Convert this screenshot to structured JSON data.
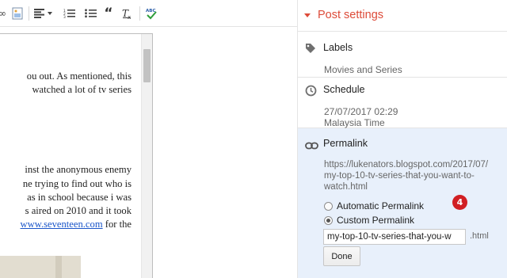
{
  "editor": {
    "lines": [
      "ou out. As mentioned, this",
      "watched a lot of tv series",
      "inst the anonymous enemy",
      "ne trying to find out who is",
      "as in school because i was",
      "s aired on 2010 and it took",
      "for the"
    ],
    "link_text": "www.seventeen.com"
  },
  "post_settings": {
    "title": "Post settings",
    "labels": {
      "title": "Labels",
      "value": "Movies and Series"
    },
    "schedule": {
      "title": "Schedule",
      "date": "27/07/2017 02:29",
      "timezone": "Malaysia Time"
    },
    "permalink": {
      "title": "Permalink",
      "url_lines": [
        "https://lukenators.blogspot.com/2017/07/",
        "my-top-10-tv-series-that-you-want-to-",
        "watch.html"
      ],
      "option_automatic": "Automatic Permalink",
      "option_custom": "Custom Permalink",
      "selected": "custom",
      "input_value": "my-top-10-tv-series-that-you-w",
      "suffix": ".html",
      "done_label": "Done",
      "step_badge": "4"
    }
  },
  "colors": {
    "accent": "#dd4b39",
    "permalink_bg": "#e8f0fb",
    "badge": "#d11f23",
    "link": "#1a55c9"
  }
}
